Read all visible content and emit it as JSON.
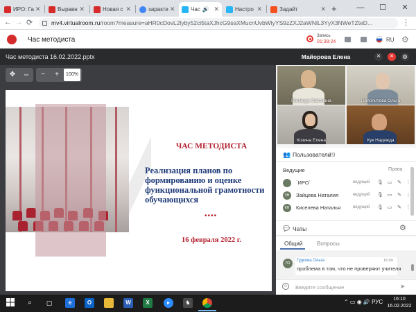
{
  "browser": {
    "tabs": [
      {
        "title": "ИРО: Га",
        "icon": "iro-favicon",
        "color": "#d62b2b"
      },
      {
        "title": "Выравн",
        "icon": "iro-favicon",
        "color": "#d62b2b"
      },
      {
        "title": "Новая с",
        "icon": "iro-favicon",
        "color": "#d62b2b"
      },
      {
        "title": "характе",
        "icon": "google-favicon",
        "color": "#4285f4"
      },
      {
        "title": "Час",
        "icon": "virtualroom-favicon",
        "color": "#29b6f6"
      },
      {
        "title": "Настро",
        "icon": "virtualroom-favicon",
        "color": "#29b6f6"
      },
      {
        "title": "Задайт",
        "icon": "form-favicon",
        "color": "#f4511e"
      }
    ],
    "new_tab": "+",
    "window_controls": [
      "—",
      "☐",
      "✕"
    ],
    "url_host": "mv4.virtualroom.ru",
    "url_path": "/room?measure=aHR0cDovL2lyby52ci5taXJhcG9saXMucnUvbWlyYS9zZXJ2aWNlL3YyX3NWeTZteD..."
  },
  "app": {
    "title": "Час методиста",
    "record_label": "Запись",
    "record_time": "01:39:24",
    "lang": "RU"
  },
  "presentation": {
    "filename": "Час методиста 16.02.2022.pptx",
    "zoom": "100%",
    "tool_minus": "−",
    "tool_plus": "+"
  },
  "slide": {
    "heading": "ЧАС МЕТОДИСТА",
    "body": "Реализация планов по формированию и оценке функциональной грамотности обучающихся",
    "dots": "••••",
    "date": "16 февраля 2022 г."
  },
  "video": {
    "presenter": "Майорова Елена",
    "tiles": [
      {
        "name": "Полищук Светлана"
      },
      {
        "name": "Пополитова Ольга"
      },
      {
        "name": "Козина Елена"
      },
      {
        "name": "Кук Надежда"
      }
    ]
  },
  "users": {
    "title": "Пользователи",
    "count": "29",
    "section_hosts": "Ведущие",
    "rights_label": "Права",
    "rows": [
      {
        "initials": "",
        "name": "`ИРО`",
        "role": "ведущий"
      },
      {
        "initials": "ЗН",
        "name": "Зайцева Наталия",
        "role": "ведущий"
      },
      {
        "initials": "КН",
        "name": "Киселева Наталья",
        "role": "ведущий"
      }
    ]
  },
  "chat": {
    "title": "Чаты",
    "tab_general": "Общий",
    "tab_questions": "Вопросы",
    "messages": [
      {
        "initials": "ГО",
        "author": "Гудкова Ольга",
        "time": "16:09",
        "text": "проблема в том, что не проверяют учителя"
      }
    ],
    "input_placeholder": "Введите сообщение"
  },
  "taskbar": {
    "lang": "РУС",
    "time": "16:10",
    "date": "16.02.2022",
    "accent": "#76b9ed"
  }
}
